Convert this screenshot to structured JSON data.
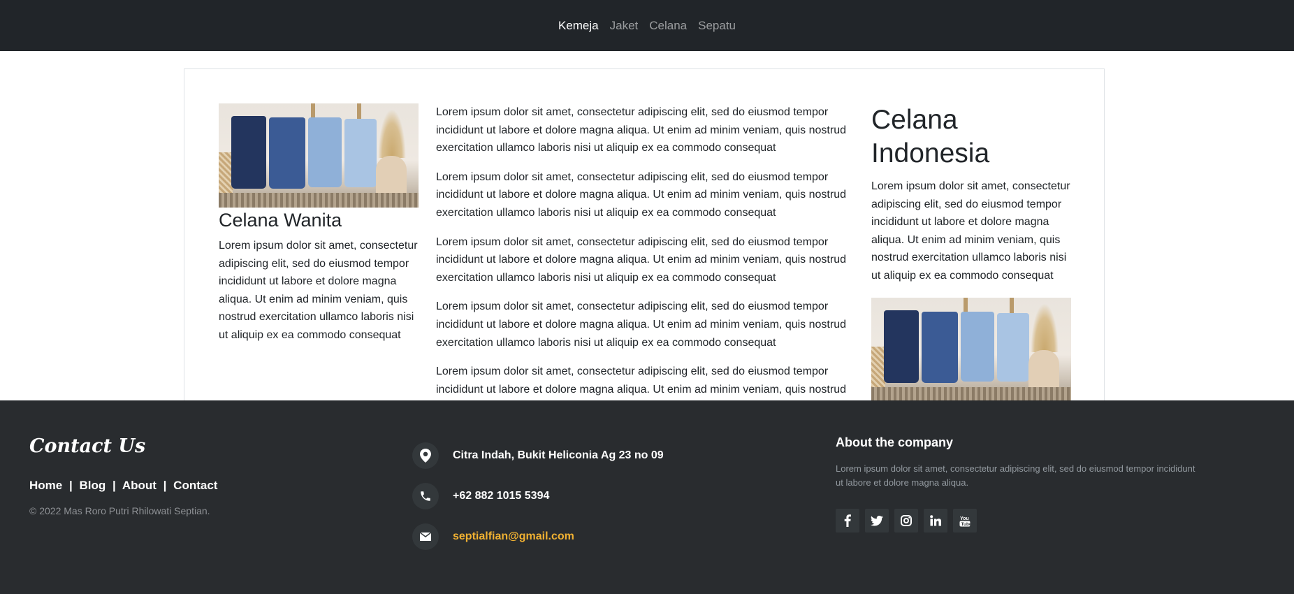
{
  "nav": {
    "links": [
      {
        "label": "Kemeja",
        "active": true
      },
      {
        "label": "Jaket",
        "active": false
      },
      {
        "label": "Celana",
        "active": false
      },
      {
        "label": "Sepatu",
        "active": false
      }
    ]
  },
  "content": {
    "left": {
      "title": "Celana Wanita",
      "text": "Lorem ipsum dolor sit amet, consectetur adipiscing elit, sed do eiusmod tempor incididunt ut labore et dolore magna aliqua. Ut enim ad minim veniam, quis nostrud exercitation ullamco laboris nisi ut aliquip ex ea commodo consequat"
    },
    "middle": {
      "paragraphs": [
        "Lorem ipsum dolor sit amet, consectetur adipiscing elit, sed do eiusmod tempor incididunt ut labore et dolore magna aliqua. Ut enim ad minim veniam, quis nostrud exercitation ullamco laboris nisi ut aliquip ex ea commodo consequat",
        "Lorem ipsum dolor sit amet, consectetur adipiscing elit, sed do eiusmod tempor incididunt ut labore et dolore magna aliqua. Ut enim ad minim veniam, quis nostrud exercitation ullamco laboris nisi ut aliquip ex ea commodo consequat",
        "Lorem ipsum dolor sit amet, consectetur adipiscing elit, sed do eiusmod tempor incididunt ut labore et dolore magna aliqua. Ut enim ad minim veniam, quis nostrud exercitation ullamco laboris nisi ut aliquip ex ea commodo consequat",
        "Lorem ipsum dolor sit amet, consectetur adipiscing elit, sed do eiusmod tempor incididunt ut labore et dolore magna aliqua. Ut enim ad minim veniam, quis nostrud exercitation ullamco laboris nisi ut aliquip ex ea commodo consequat",
        "Lorem ipsum dolor sit amet, consectetur adipiscing elit, sed do eiusmod tempor incididunt ut labore et dolore magna aliqua. Ut enim ad minim veniam, quis nostrud"
      ]
    },
    "right": {
      "title": "Celana Indonesia",
      "text": "Lorem ipsum dolor sit amet, consectetur adipiscing elit, sed do eiusmod tempor incididunt ut labore et dolore magna aliqua. Ut enim ad minim veniam, quis nostrud exercitation ullamco laboris nisi ut aliquip ex ea commodo consequat"
    }
  },
  "footer": {
    "brand": "Contact Us",
    "links": [
      "Home",
      "Blog",
      "About",
      "Contact"
    ],
    "separator": "|",
    "copyright": "© 2022 Mas Roro Putri Rhilowati Septian.",
    "contacts": {
      "address": {
        "icon": "map-marker-icon",
        "text": "Citra Indah, Bukit Heliconia Ag 23 no 09"
      },
      "phone": {
        "icon": "phone-icon",
        "text": "+62 882 1015 5394"
      },
      "email": {
        "icon": "envelope-icon",
        "text": "septialfian@gmail.com"
      }
    },
    "about": {
      "title": "About the company",
      "text": "Lorem ipsum dolor sit amet, consectetur adipiscing elit, sed do eiusmod tempor incididunt ut labore et dolore magna aliqua."
    },
    "socials": [
      "facebook-icon",
      "twitter-icon",
      "instagram-icon",
      "linkedin-icon",
      "youtube-icon"
    ],
    "colors": {
      "background": "#292c2f",
      "accent": "#f0b132"
    }
  }
}
